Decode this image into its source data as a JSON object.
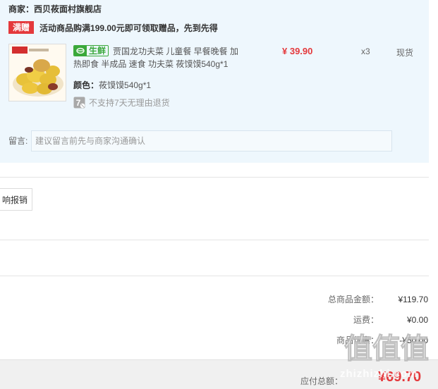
{
  "shop": {
    "label": "商家：西贝莜面村旗舰店"
  },
  "promo": {
    "tag": "满赠",
    "text": "活动商品购满199.00元即可领取赠品，先到先得"
  },
  "item": {
    "image_icon": "dumpling-product-image",
    "fresh_tag": "生鲜",
    "title": "贾国龙功夫菜 儿童餐 早餐晚餐 加热即食 半成品 速食 功夫菜 莜馍馍540g*1",
    "attr_label": "颜色：",
    "attr_value": "莜馍馍540g*1",
    "no_return_badge": "7",
    "no_return_text": "不支持7天无理由退货",
    "price": "¥ 39.90",
    "quantity": "x3",
    "stock": "现货"
  },
  "remark": {
    "label": "留言:",
    "placeholder": "建议留言前先与商家沟通确认"
  },
  "report_button": "响报销",
  "summary": {
    "total_label": "总商品金额：",
    "total_value": "¥119.70",
    "shipping_label": "运费：",
    "shipping_value": "¥0.00",
    "discount_label": "商品优惠：",
    "discount_value": "-¥50.00"
  },
  "payable": {
    "label": "应付总额：",
    "value": "¥69.70"
  },
  "watermark": {
    "logo_text": "值值值",
    "site": "zhizhizhi.com"
  },
  "colors": {
    "accent_red": "#e4393c",
    "fresh_green": "#3aa83a",
    "panel_bg": "#eef7fd"
  }
}
